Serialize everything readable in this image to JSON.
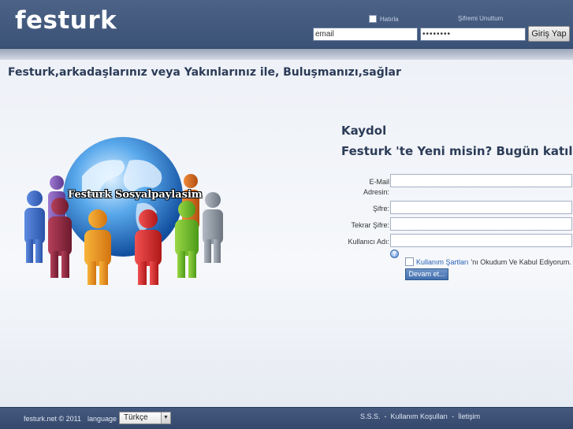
{
  "header": {
    "logo": "festurk",
    "remember_label": "Hatırla",
    "forgot_label": "Şifremi Unuttum",
    "email_value": "email",
    "password_value": "••••••••",
    "login_label": "Giriş Yap"
  },
  "main": {
    "tagline": "Festurk,arkadaşlarınız veya Yakınlarınız ile, Buluşmanızı,sağlar",
    "hero_text": "Festurk Sosyalpaylasim"
  },
  "register": {
    "title": "Kaydol",
    "subtitle": "Festurk 'te Yeni misin? Bugün katıl!",
    "email_label_line1": "E-Mail",
    "email_label_line2": "Adresin:",
    "password_label": "Şifre:",
    "password_repeat_label": "Tekrar Şifre:",
    "username_label": "Kullanıcı Adı:",
    "help_glyph": "?",
    "terms_link": "Kullanım Şartları",
    "terms_text": "'nı Okudum Ve Kabul Ediyorum.",
    "continue_label": "Devam et..."
  },
  "footer": {
    "copyright": "festurk.net © 2011",
    "language_label": "language",
    "language_value": "Türkçe",
    "links": [
      "S.S.S.",
      "-",
      "Kullanım Koşulları",
      "-",
      "İletişim"
    ]
  },
  "colors": {
    "header_bg": "#3b5277",
    "accent": "#2c3c58",
    "link": "#2a62b5",
    "button": "#426fae"
  },
  "icons": {
    "help": "help-icon",
    "select_arrow": "chevron-down-icon",
    "hero": "globe-people-illustration"
  }
}
